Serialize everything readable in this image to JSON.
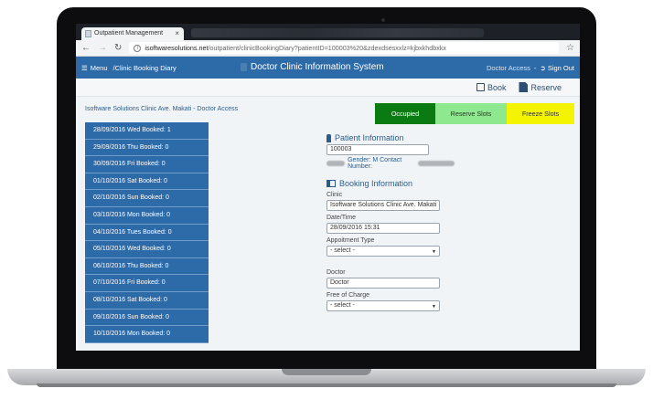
{
  "browser": {
    "tab_title": "Outpatient Management",
    "tab_close": "×",
    "url_host": "isoftwaresolutions.net",
    "url_path": "/outpatient/clinicBookingDiary?patientID=100003%20&zdexdsesxxlz=kjbxkhdbxkx"
  },
  "header": {
    "menu_label": "Menu",
    "breadcrumb": "/Clinic Booking Diary",
    "system_title": "Doctor Clinic Information System",
    "access_label": "Doctor Access",
    "separator": "-",
    "sign_out_label": "Sign Out"
  },
  "toolbar": {
    "book_label": "Book",
    "reserve_label": "Reserve"
  },
  "caption": "Isoftware Solutions Clinic Ave. Makati - Doctor Access",
  "legend": {
    "occupied": "Occupied",
    "reserve_slots": "Reserve Slots",
    "freeze_slots": "Freeze Slots",
    "colors": {
      "occupied": "#0a7b12",
      "reserve": "#8ee88e",
      "freeze": "#f4f400"
    }
  },
  "days": [
    "28/09/2016 Wed Booked: 1",
    "29/09/2016 Thu Booked: 0",
    "30/09/2016 Fri Booked: 0",
    "01/10/2016 Sat Booked: 0",
    "02/10/2016 Sun Booked: 0",
    "03/10/2016 Mon Booked: 0",
    "04/10/2016 Tues Booked: 0",
    "05/10/2016 Wed Booked: 0",
    "06/10/2016 Thu Booked: 0",
    "07/10/2016 Fri Booked: 0",
    "08/10/2016 Sat Booked: 0",
    "09/10/2016 Sun Booked: 0",
    "10/10/2016 Mon Booked: 0"
  ],
  "patient": {
    "section_title": "Patient Information",
    "patient_id": "100003",
    "gender_text": "Gender: M Contact Number:"
  },
  "booking": {
    "section_title": "Booking Information",
    "clinic_label": "Clinic",
    "clinic_value": "Isoftware Solutions Clinic Ave. Makati",
    "datetime_label": "Date/Time",
    "datetime_value": "28/09/2016 15:31",
    "appt_type_label": "Appoitment Type",
    "appt_type_value": "- select -",
    "doctor_label": "Doctor",
    "doctor_value": "Doctor",
    "free_of_charge_label": "Free of Charge",
    "free_of_charge_value": "- select -"
  },
  "colors": {
    "header_blue": "#2d6aa8",
    "day_blue": "#2d6aa8"
  }
}
